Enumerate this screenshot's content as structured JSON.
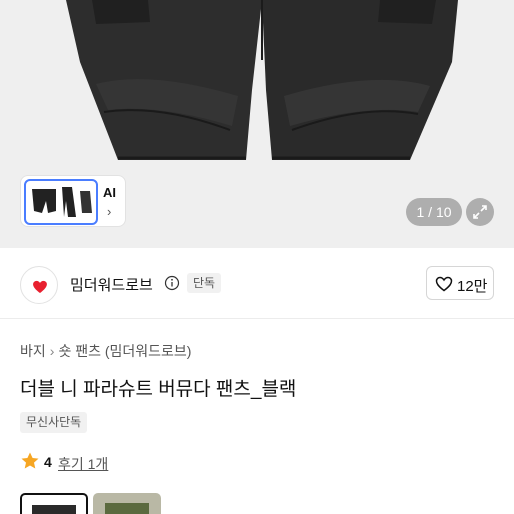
{
  "gallery": {
    "thumbnail_label": "AI",
    "counter": "1 / 10"
  },
  "store": {
    "name": "밈더워드로브",
    "badge": "단독",
    "likes": "12만"
  },
  "product": {
    "breadcrumb": [
      "바지",
      "숏 팬츠",
      "(밈더워드로브)"
    ],
    "title": "더블 니 파라슈트 버뮤다 팬츠_블랙",
    "exclusive_badge": "무신사단독",
    "rating": "4",
    "reviews": "후기 1개"
  },
  "colors": {
    "accent": "#4a7dff",
    "brand_red": "#e8202f",
    "star": "#f6a623"
  },
  "icons": [
    "chevron-right-icon",
    "expand-icon",
    "info-icon",
    "heart-icon",
    "star-icon"
  ]
}
